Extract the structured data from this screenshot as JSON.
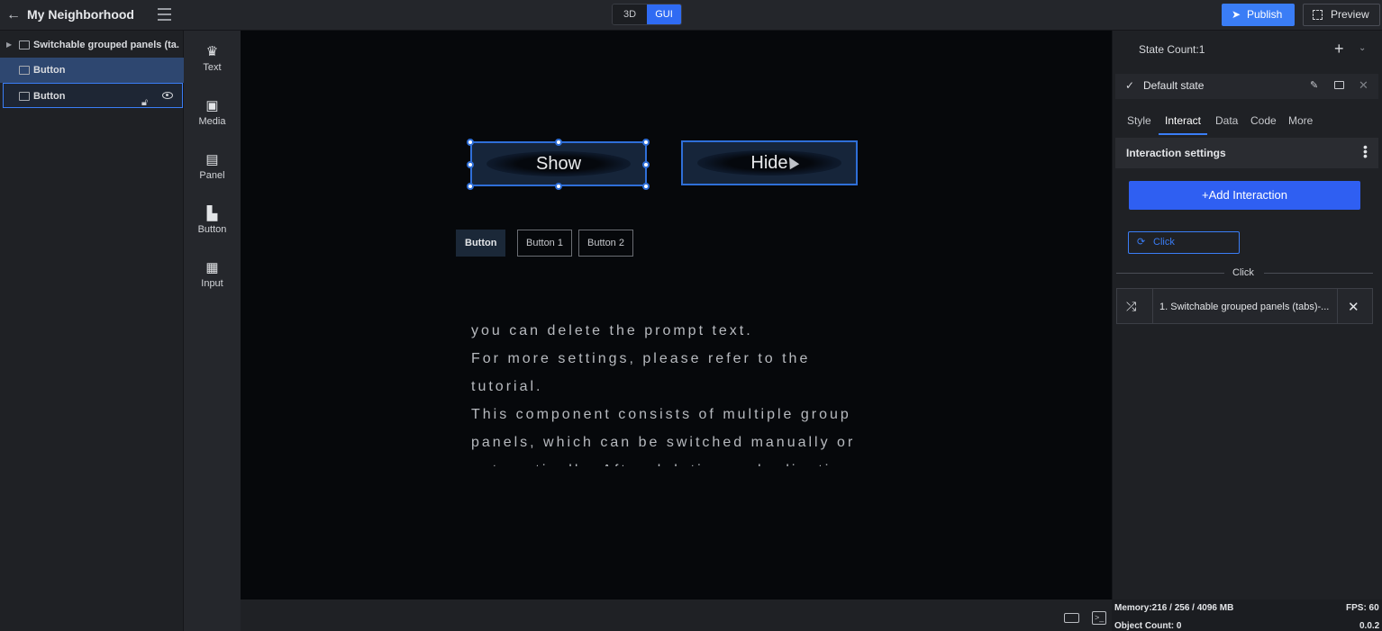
{
  "header": {
    "title": "My Neighborhood",
    "modes": [
      "3D",
      "GUI"
    ],
    "active_mode": "GUI",
    "publish_label": "Publish",
    "preview_label": "Preview"
  },
  "tree": {
    "items": [
      {
        "label": "Switchable grouped panels (ta..."
      },
      {
        "label": "Button"
      },
      {
        "label": "Button"
      }
    ]
  },
  "palette": {
    "items": [
      {
        "label": "Text",
        "icon": "crown-icon"
      },
      {
        "label": "Media",
        "icon": "camera-icon"
      },
      {
        "label": "Panel",
        "icon": "panel-icon"
      },
      {
        "label": "Button",
        "icon": "bar-chart-icon"
      },
      {
        "label": "Input",
        "icon": "map-icon"
      }
    ]
  },
  "canvas": {
    "show_label": "Show",
    "hide_label": "Hide",
    "tabs": [
      "Button",
      "Button 1",
      "Button 2"
    ],
    "prompt_lines": [
      "you can delete the prompt text.",
      "For more settings, please refer to the",
      "tutorial.",
      "This component consists of multiple group",
      "panels, which can be switched manually or",
      "automatically. After deleting and adjusting"
    ]
  },
  "right_panel": {
    "state_count": "State Count:1",
    "default_state": "Default state",
    "tabs": [
      "Style",
      "Interact",
      "Data",
      "Code",
      "More"
    ],
    "active_tab": "Interact",
    "interaction_title": "Interaction settings",
    "add_interaction": "Add Interaction",
    "trigger_label": "Click",
    "group_label": "Click",
    "action_label": "1. Switchable grouped panels (tabs)-..."
  },
  "status": {
    "memory": "Memory:216 / 256 / 4096 MB",
    "fps": "FPS: 60",
    "object_count": "Object Count: 0",
    "version": "0.0.2"
  },
  "colors": {
    "accent": "#2f6bf3",
    "canvas_bg": "#06080b",
    "panel_bg": "#1f2125"
  }
}
